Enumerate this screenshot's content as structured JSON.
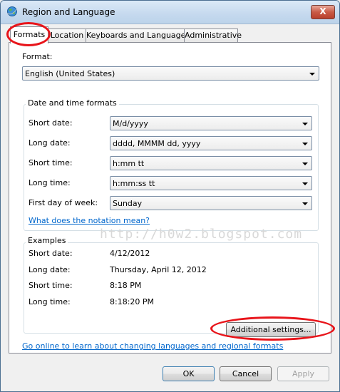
{
  "window": {
    "title": "Region and Language",
    "close_glyph": "X"
  },
  "tabs": [
    {
      "label": "Formats",
      "active": true
    },
    {
      "label": "Location",
      "active": false
    },
    {
      "label": "Keyboards and Languages",
      "active": false
    },
    {
      "label": "Administrative",
      "active": false
    }
  ],
  "format": {
    "label": "Format:",
    "value": "English (United States)"
  },
  "date_time": {
    "group_title": "Date and time formats",
    "short_date": {
      "label": "Short date:",
      "value": "M/d/yyyy"
    },
    "long_date": {
      "label": "Long date:",
      "value": "dddd, MMMM dd, yyyy"
    },
    "short_time": {
      "label": "Short time:",
      "value": "h:mm tt"
    },
    "long_time": {
      "label": "Long time:",
      "value": "h:mm:ss tt"
    },
    "first_day": {
      "label": "First day of week:",
      "value": "Sunday"
    },
    "notation_link": "What does the notation mean?"
  },
  "examples": {
    "group_title": "Examples",
    "short_date": {
      "label": "Short date:",
      "value": "4/12/2012"
    },
    "long_date": {
      "label": "Long date:",
      "value": "Thursday, April 12, 2012"
    },
    "short_time": {
      "label": "Short time:",
      "value": "8:18 PM"
    },
    "long_time": {
      "label": "Long time:",
      "value": "8:18:20 PM"
    }
  },
  "watermark": "http://h0w2.blogspot.com",
  "additional_settings_label": "Additional settings...",
  "online_link": "Go online to learn about changing languages and regional formats",
  "buttons": {
    "ok": "OK",
    "cancel": "Cancel",
    "apply": "Apply"
  },
  "colors": {
    "link": "#0066cc",
    "highlight_ellipse": "#e8141a"
  }
}
